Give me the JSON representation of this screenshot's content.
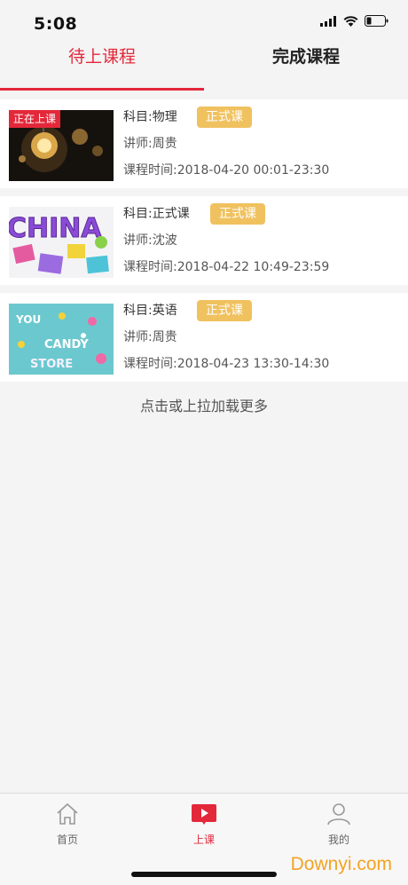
{
  "status_bar": {
    "time": "5:08"
  },
  "tabs": {
    "pending": "待上课程",
    "completed": "完成课程"
  },
  "courses": [
    {
      "live_badge": "正在上课",
      "subject": "科目:物理",
      "type": "正式课",
      "teacher": "讲师:周贵",
      "time": "课程时间:2018-04-20 00:01-23:30"
    },
    {
      "subject": "科目:正式课",
      "type": "正式课",
      "teacher": "讲师:沈波",
      "time": "课程时间:2018-04-22 10:49-23:59",
      "thumb_text": "CHINA"
    },
    {
      "subject": "科目:英语",
      "type": "正式课",
      "teacher": "讲师:周贵",
      "time": "课程时间:2018-04-23 13:30-14:30",
      "thumb_text": [
        "YOU",
        "CANDY",
        "STORE"
      ]
    }
  ],
  "load_more": "点击或上拉加载更多",
  "tabbar": {
    "home": "首页",
    "class": "上课",
    "mine": "我的"
  },
  "watermark": "Downyi.com",
  "colors": {
    "accent": "#e3283a",
    "badge": "#f0c15f",
    "background": "#f4f4f4"
  },
  "icons": [
    "signal-icon",
    "wifi-icon",
    "battery-icon",
    "home-icon",
    "play-icon",
    "user-icon"
  ]
}
